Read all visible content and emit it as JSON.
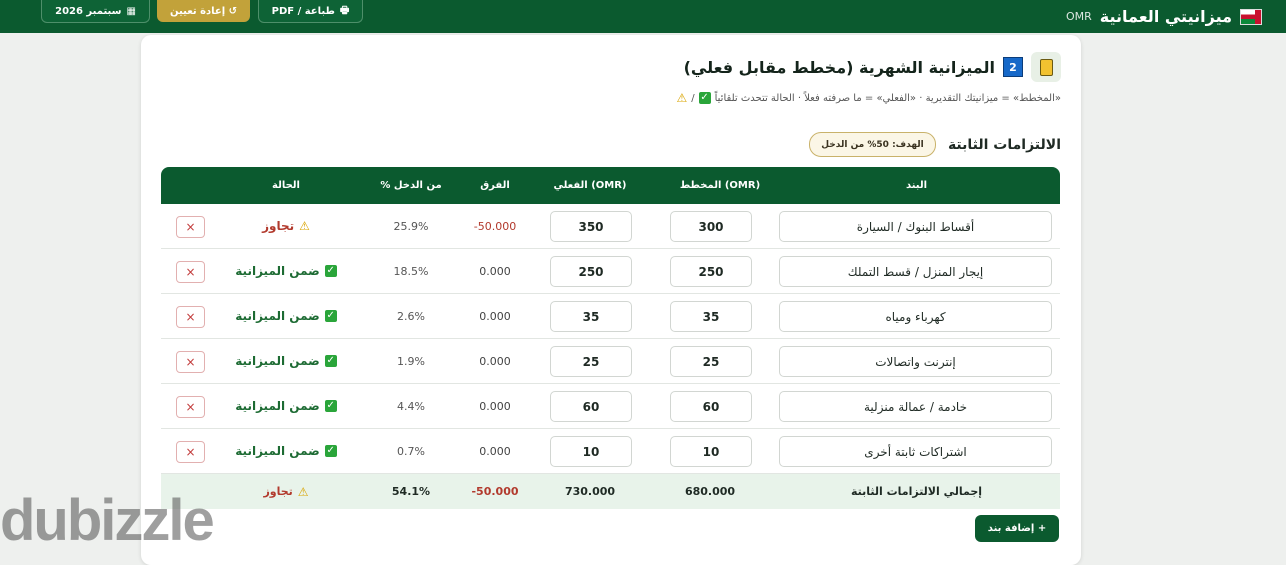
{
  "topbar": {
    "title": "ميزانيتي العمانية",
    "currency": "OMR",
    "print_label": "طباعة / PDF",
    "reset_label": "↺ إعادة تعيين",
    "month_label": "سبتمبر 2026",
    "bg_color": "#0b5a2f"
  },
  "header": {
    "step": "2",
    "title": "الميزانية الشهرية (مخطط مقابل فعلي)",
    "note": "«المخطط» = ميزانيتك التقديرية · «الفعلي» = ما صرفته فعلاً · الحالة تتحدث تلقائياً"
  },
  "section": {
    "title": "الالتزامات الثابتة",
    "goal": "الهدف: 50% من الدخل"
  },
  "table": {
    "headers": {
      "item": "البند",
      "plan": "المخطط (OMR)",
      "actual": "الفعلي (OMR)",
      "diff": "الفرق",
      "pct": "% من الدخل",
      "status": "الحالة"
    },
    "rows": [
      {
        "item": "أقساط البنوك / السيارة",
        "plan": "300",
        "actual": "350",
        "diff": "-50.000",
        "pct": "25.9%",
        "status": "تجاوز",
        "state": "over"
      },
      {
        "item": "إيجار المنزل / قسط التملك",
        "plan": "250",
        "actual": "250",
        "diff": "0.000",
        "pct": "18.5%",
        "status": "ضمن الميزانية",
        "state": "ok"
      },
      {
        "item": "كهرباء ومياه",
        "plan": "35",
        "actual": "35",
        "diff": "0.000",
        "pct": "2.6%",
        "status": "ضمن الميزانية",
        "state": "ok"
      },
      {
        "item": "إنترنت واتصالات",
        "plan": "25",
        "actual": "25",
        "diff": "0.000",
        "pct": "1.9%",
        "status": "ضمن الميزانية",
        "state": "ok"
      },
      {
        "item": "خادمة / عمالة منزلية",
        "plan": "60",
        "actual": "60",
        "diff": "0.000",
        "pct": "4.4%",
        "status": "ضمن الميزانية",
        "state": "ok"
      },
      {
        "item": "اشتراكات ثابتة أخرى",
        "plan": "10",
        "actual": "10",
        "diff": "0.000",
        "pct": "0.7%",
        "status": "ضمن الميزانية",
        "state": "ok"
      }
    ],
    "total": {
      "label": "إجمالي الالتزامات الثابتة",
      "plan": "680.000",
      "actual": "730.000",
      "diff": "-50.000",
      "pct": "54.1%",
      "status": "تجاوز"
    },
    "delete_glyph": "×"
  },
  "add_button": "+ إضافة بند",
  "watermark": "dubizzle"
}
